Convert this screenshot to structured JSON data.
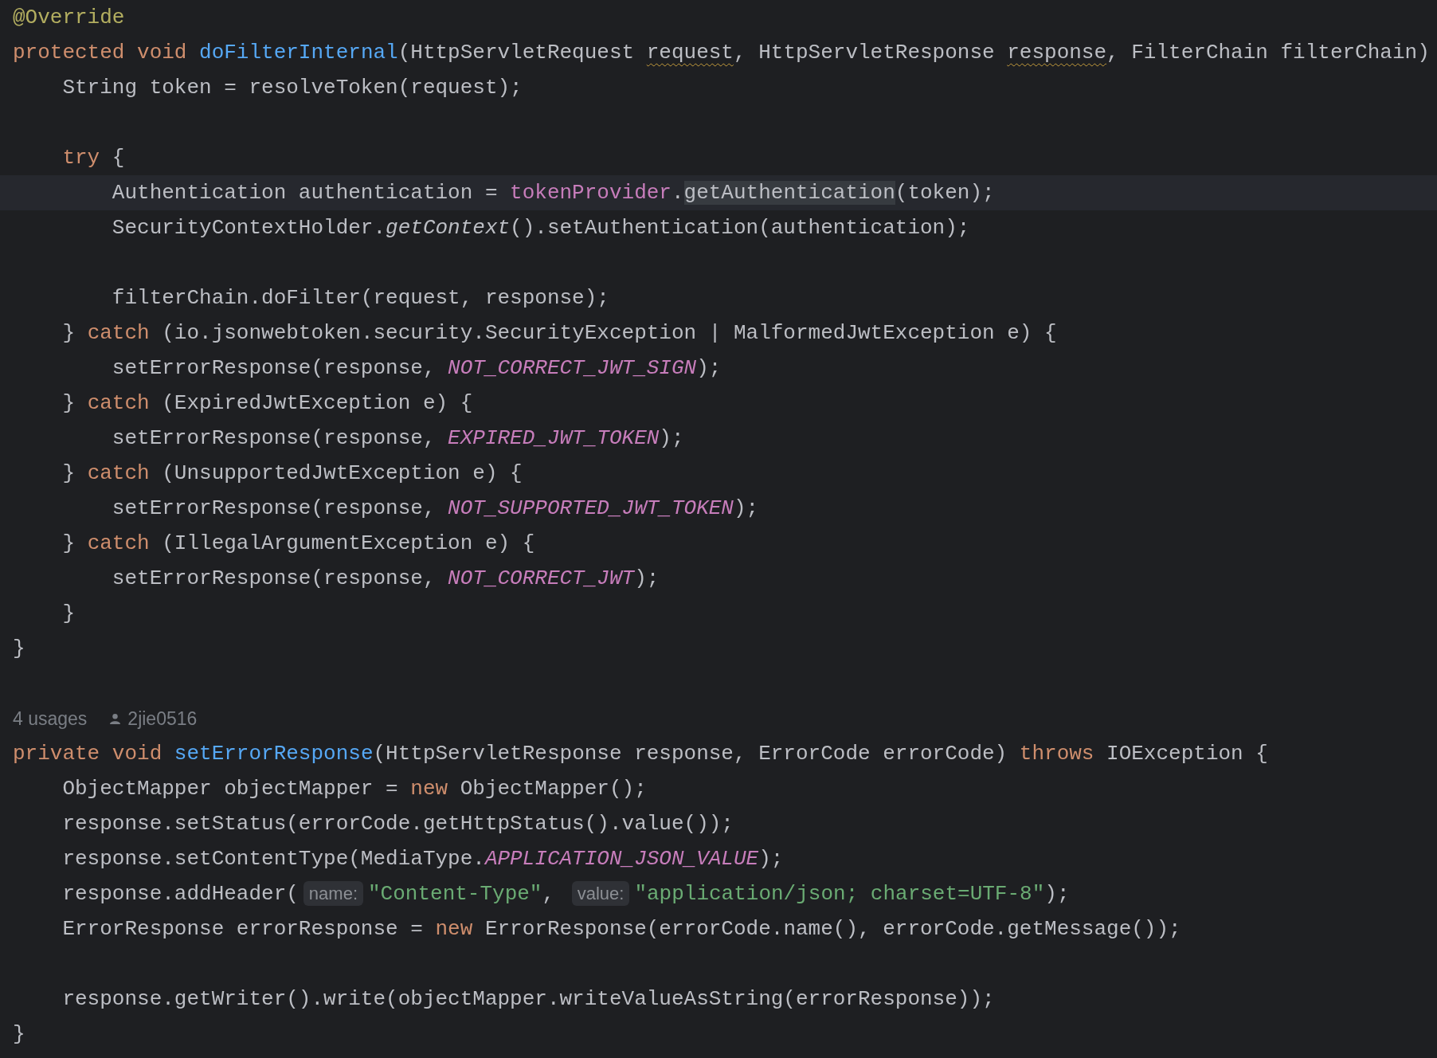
{
  "editor": {
    "lines": [
      {
        "kind": "code",
        "current": false,
        "tokens": [
          {
            "t": "@Override",
            "kind": "annotation"
          }
        ]
      },
      {
        "kind": "code",
        "current": false,
        "tokens": [
          {
            "t": "protected void ",
            "kind": "keyword"
          },
          {
            "t": "doFilterInternal",
            "kind": "decl"
          },
          {
            "t": "(HttpServletRequest ",
            "kind": "plain"
          },
          {
            "t": "request",
            "kind": "warn"
          },
          {
            "t": ", HttpServletResponse ",
            "kind": "plain"
          },
          {
            "t": "response",
            "kind": "warn"
          },
          {
            "t": ", FilterChain filterChain)",
            "kind": "plain"
          }
        ]
      },
      {
        "kind": "code",
        "current": false,
        "tokens": [
          {
            "t": "    String token = resolveToken(request);",
            "kind": "plain"
          }
        ]
      },
      {
        "kind": "code",
        "current": false
      },
      {
        "kind": "code",
        "current": false,
        "tokens": [
          {
            "t": "    try",
            "kind": "keyword"
          },
          {
            "t": " {",
            "kind": "plain"
          }
        ]
      },
      {
        "kind": "code",
        "current": true,
        "tokens": [
          {
            "t": "        Authentication authentication = ",
            "kind": "plain"
          },
          {
            "t": "tokenProvider",
            "kind": "field"
          },
          {
            "t": ".",
            "kind": "plain"
          },
          {
            "t": "getAuthentication",
            "kind": "match"
          },
          {
            "t": "(token);",
            "kind": "plain"
          }
        ]
      },
      {
        "kind": "code",
        "current": false,
        "tokens": [
          {
            "t": "        SecurityContextHolder.",
            "kind": "plain"
          },
          {
            "t": "getContext",
            "kind": "italic"
          },
          {
            "t": "().setAuthentication(authentication);",
            "kind": "plain"
          }
        ]
      },
      {
        "kind": "code",
        "current": false
      },
      {
        "kind": "code",
        "current": false,
        "tokens": [
          {
            "t": "        filterChain.doFilter(request, response);",
            "kind": "plain"
          }
        ]
      },
      {
        "kind": "code",
        "current": false,
        "tokens": [
          {
            "t": "    } ",
            "kind": "plain"
          },
          {
            "t": "catch",
            "kind": "keyword"
          },
          {
            "t": " (io.jsonwebtoken.security.SecurityException | MalformedJwtException e) {",
            "kind": "plain"
          }
        ]
      },
      {
        "kind": "code",
        "current": false,
        "tokens": [
          {
            "t": "        setErrorResponse(response, ",
            "kind": "plain"
          },
          {
            "t": "NOT_CORRECT_JWT_SIGN",
            "kind": "constant"
          },
          {
            "t": ");",
            "kind": "plain"
          }
        ]
      },
      {
        "kind": "code",
        "current": false,
        "tokens": [
          {
            "t": "    } ",
            "kind": "plain"
          },
          {
            "t": "catch",
            "kind": "keyword"
          },
          {
            "t": " (ExpiredJwtException e) {",
            "kind": "plain"
          }
        ]
      },
      {
        "kind": "code",
        "current": false,
        "tokens": [
          {
            "t": "        setErrorResponse(response, ",
            "kind": "plain"
          },
          {
            "t": "EXPIRED_JWT_TOKEN",
            "kind": "constant"
          },
          {
            "t": ");",
            "kind": "plain"
          }
        ]
      },
      {
        "kind": "code",
        "current": false,
        "tokens": [
          {
            "t": "    } ",
            "kind": "plain"
          },
          {
            "t": "catch",
            "kind": "keyword"
          },
          {
            "t": " (UnsupportedJwtException e) {",
            "kind": "plain"
          }
        ]
      },
      {
        "kind": "code",
        "current": false,
        "tokens": [
          {
            "t": "        setErrorResponse(response, ",
            "kind": "plain"
          },
          {
            "t": "NOT_SUPPORTED_JWT_TOKEN",
            "kind": "constant"
          },
          {
            "t": ");",
            "kind": "plain"
          }
        ]
      },
      {
        "kind": "code",
        "current": false,
        "tokens": [
          {
            "t": "    } ",
            "kind": "plain"
          },
          {
            "t": "catch",
            "kind": "keyword"
          },
          {
            "t": " (IllegalArgumentException e) {",
            "kind": "plain"
          }
        ]
      },
      {
        "kind": "code",
        "current": false,
        "tokens": [
          {
            "t": "        setErrorResponse(response, ",
            "kind": "plain"
          },
          {
            "t": "NOT_CORRECT_JWT",
            "kind": "constant"
          },
          {
            "t": ");",
            "kind": "plain"
          }
        ]
      },
      {
        "kind": "code",
        "current": false,
        "tokens": [
          {
            "t": "    }",
            "kind": "plain"
          }
        ]
      },
      {
        "kind": "code",
        "current": false,
        "tokens": [
          {
            "t": "}",
            "kind": "plain"
          }
        ]
      },
      {
        "kind": "code",
        "current": false
      },
      {
        "kind": "hint",
        "current": false,
        "usages": "4 usages",
        "author": "2jie0516"
      },
      {
        "kind": "code",
        "current": false,
        "tokens": [
          {
            "t": "private void ",
            "kind": "keyword"
          },
          {
            "t": "setErrorResponse",
            "kind": "decl"
          },
          {
            "t": "(HttpServletResponse response, ErrorCode errorCode) ",
            "kind": "plain"
          },
          {
            "t": "throws",
            "kind": "keyword"
          },
          {
            "t": " IOException {",
            "kind": "plain"
          }
        ]
      },
      {
        "kind": "code",
        "current": false,
        "tokens": [
          {
            "t": "    ObjectMapper objectMapper = ",
            "kind": "plain"
          },
          {
            "t": "new",
            "kind": "keyword"
          },
          {
            "t": " ObjectMapper();",
            "kind": "plain"
          }
        ]
      },
      {
        "kind": "code",
        "current": false,
        "tokens": [
          {
            "t": "    response.setStatus(errorCode.getHttpStatus().value());",
            "kind": "plain"
          }
        ]
      },
      {
        "kind": "code",
        "current": false,
        "tokens": [
          {
            "t": "    response.setContentType(MediaType.",
            "kind": "plain"
          },
          {
            "t": "APPLICATION_JSON_VALUE",
            "kind": "constant"
          },
          {
            "t": ");",
            "kind": "plain"
          }
        ]
      },
      {
        "kind": "code",
        "current": false,
        "tokens": [
          {
            "t": "    response.addHeader(",
            "kind": "plain"
          },
          {
            "t": "name:",
            "kind": "inlay"
          },
          {
            "t": "\"Content-Type\"",
            "kind": "string"
          },
          {
            "t": ", ",
            "kind": "plain"
          },
          {
            "t": "value:",
            "kind": "inlay"
          },
          {
            "t": "\"application/json; charset=UTF-8\"",
            "kind": "string"
          },
          {
            "t": ");",
            "kind": "plain"
          }
        ]
      },
      {
        "kind": "code",
        "current": false,
        "tokens": [
          {
            "t": "    ErrorResponse errorResponse = ",
            "kind": "plain"
          },
          {
            "t": "new",
            "kind": "keyword"
          },
          {
            "t": " ErrorResponse(errorCode.name(), errorCode.getMessage());",
            "kind": "plain"
          }
        ]
      },
      {
        "kind": "code",
        "current": false
      },
      {
        "kind": "code",
        "current": false,
        "tokens": [
          {
            "t": "    response.getWriter().write(objectMapper.writeValueAsString(errorResponse));",
            "kind": "plain"
          }
        ]
      },
      {
        "kind": "code",
        "current": false,
        "tokens": [
          {
            "t": "}",
            "kind": "plain"
          }
        ]
      }
    ]
  }
}
